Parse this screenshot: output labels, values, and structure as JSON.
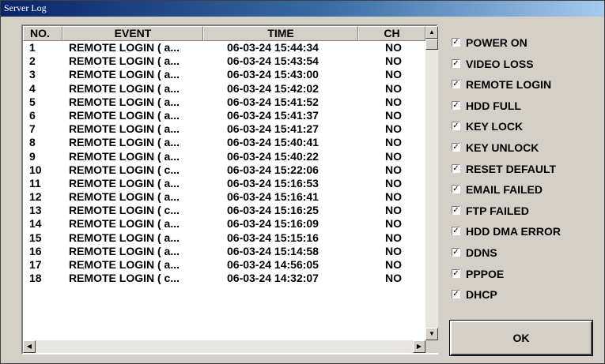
{
  "window": {
    "title": "Server Log"
  },
  "table": {
    "columns": [
      "NO.",
      "EVENT",
      "TIME",
      "CH"
    ],
    "rows": [
      {
        "no": "1",
        "event": "REMOTE LOGIN ( a...",
        "time": "06-03-24 15:44:34",
        "ch": "NO"
      },
      {
        "no": "2",
        "event": "REMOTE LOGIN ( a...",
        "time": "06-03-24 15:43:54",
        "ch": "NO"
      },
      {
        "no": "3",
        "event": "REMOTE LOGIN ( a...",
        "time": "06-03-24 15:43:00",
        "ch": "NO"
      },
      {
        "no": "4",
        "event": "REMOTE LOGIN ( a...",
        "time": "06-03-24 15:42:02",
        "ch": "NO"
      },
      {
        "no": "5",
        "event": "REMOTE LOGIN ( a...",
        "time": "06-03-24 15:41:52",
        "ch": "NO"
      },
      {
        "no": "6",
        "event": "REMOTE LOGIN ( a...",
        "time": "06-03-24 15:41:37",
        "ch": "NO"
      },
      {
        "no": "7",
        "event": "REMOTE LOGIN ( a...",
        "time": "06-03-24 15:41:27",
        "ch": "NO"
      },
      {
        "no": "8",
        "event": "REMOTE LOGIN ( a...",
        "time": "06-03-24 15:40:41",
        "ch": "NO"
      },
      {
        "no": "9",
        "event": "REMOTE LOGIN ( a...",
        "time": "06-03-24 15:40:22",
        "ch": "NO"
      },
      {
        "no": "10",
        "event": "REMOTE LOGIN ( c...",
        "time": "06-03-24 15:22:06",
        "ch": "NO"
      },
      {
        "no": "11",
        "event": "REMOTE LOGIN ( a...",
        "time": "06-03-24 15:16:53",
        "ch": "NO"
      },
      {
        "no": "12",
        "event": "REMOTE LOGIN ( a...",
        "time": "06-03-24 15:16:41",
        "ch": "NO"
      },
      {
        "no": "13",
        "event": "REMOTE LOGIN ( c...",
        "time": "06-03-24 15:16:25",
        "ch": "NO"
      },
      {
        "no": "14",
        "event": "REMOTE LOGIN ( a...",
        "time": "06-03-24 15:16:09",
        "ch": "NO"
      },
      {
        "no": "15",
        "event": "REMOTE LOGIN ( a...",
        "time": "06-03-24 15:15:16",
        "ch": "NO"
      },
      {
        "no": "16",
        "event": "REMOTE LOGIN ( a...",
        "time": "06-03-24 15:14:58",
        "ch": "NO"
      },
      {
        "no": "17",
        "event": "REMOTE LOGIN ( a...",
        "time": "06-03-24 14:56:05",
        "ch": "NO"
      },
      {
        "no": "18",
        "event": "REMOTE LOGIN ( c...",
        "time": "06-03-24 14:32:07",
        "ch": "NO"
      }
    ]
  },
  "scrollbar": {
    "up_icon": "arrow-up-icon",
    "down_icon": "arrow-down-icon",
    "left_icon": "arrow-left-icon",
    "right_icon": "arrow-right-icon"
  },
  "filters": [
    {
      "label": "POWER ON",
      "checked": true
    },
    {
      "label": "VIDEO LOSS",
      "checked": true
    },
    {
      "label": "REMOTE LOGIN",
      "checked": true
    },
    {
      "label": "HDD FULL",
      "checked": true
    },
    {
      "label": "KEY LOCK",
      "checked": true
    },
    {
      "label": "KEY UNLOCK",
      "checked": true
    },
    {
      "label": "RESET DEFAULT",
      "checked": true
    },
    {
      "label": "EMAIL FAILED",
      "checked": true
    },
    {
      "label": "FTP FAILED",
      "checked": true
    },
    {
      "label": "HDD DMA ERROR",
      "checked": true
    },
    {
      "label": "DDNS",
      "checked": true
    },
    {
      "label": "PPPOE",
      "checked": true
    },
    {
      "label": "DHCP",
      "checked": true
    }
  ],
  "ok_label": "OK",
  "colors": {
    "titlebar_start": "#0a246a",
    "titlebar_end": "#a6caf0",
    "face": "#d4d0c8"
  }
}
